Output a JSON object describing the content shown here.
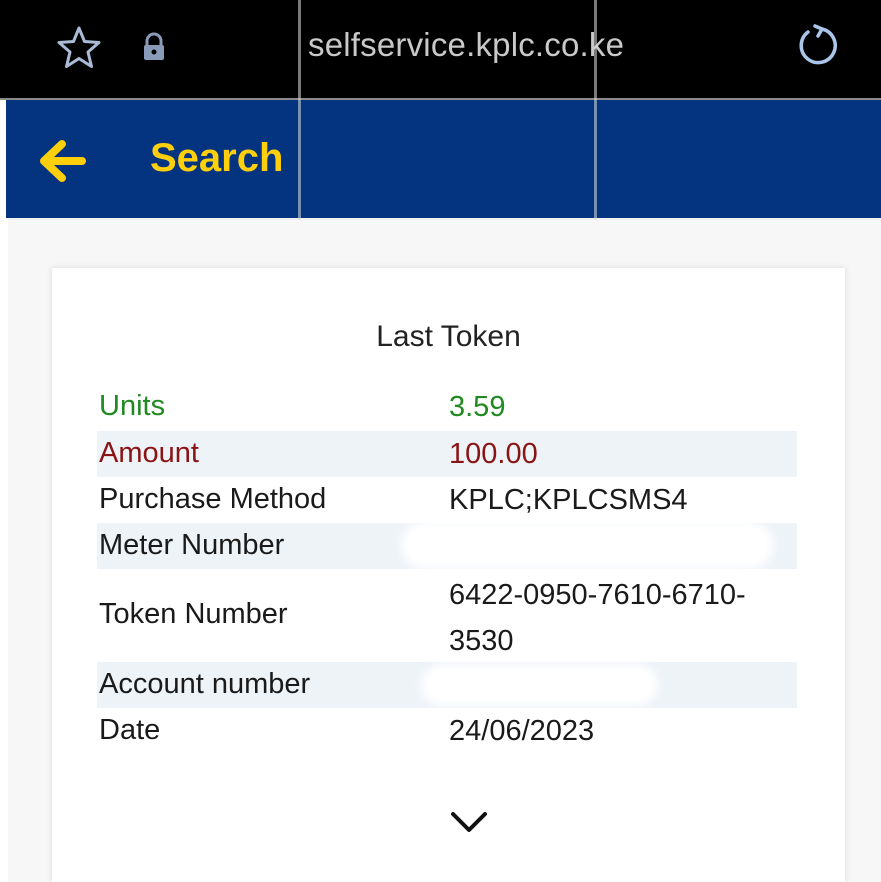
{
  "browser": {
    "url": "selfservice.kplc.co.ke",
    "icons": [
      "star-icon",
      "lock-icon",
      "reload-icon"
    ]
  },
  "app_bar": {
    "title": "Search",
    "icon": "back-arrow-icon",
    "background": "#043480",
    "accent": "#ffcf0b"
  },
  "card": {
    "title": "Last Token",
    "rows": [
      {
        "label": "Units",
        "value": "3.59"
      },
      {
        "label": "Amount",
        "value": "100.00"
      },
      {
        "label": "Purchase Method",
        "value": "KPLC;KPLCSMS4"
      },
      {
        "label": "Meter Number",
        "value": ""
      },
      {
        "label": "Token Number",
        "value": "6422-0950-7610-6710-3530"
      },
      {
        "label": "Account number",
        "value": ""
      },
      {
        "label": "Date",
        "value": "24/06/2023"
      }
    ],
    "expand_icon": "chevron-down-icon"
  },
  "colors": {
    "units": "#1f8a1f",
    "amount": "#8a1414"
  }
}
